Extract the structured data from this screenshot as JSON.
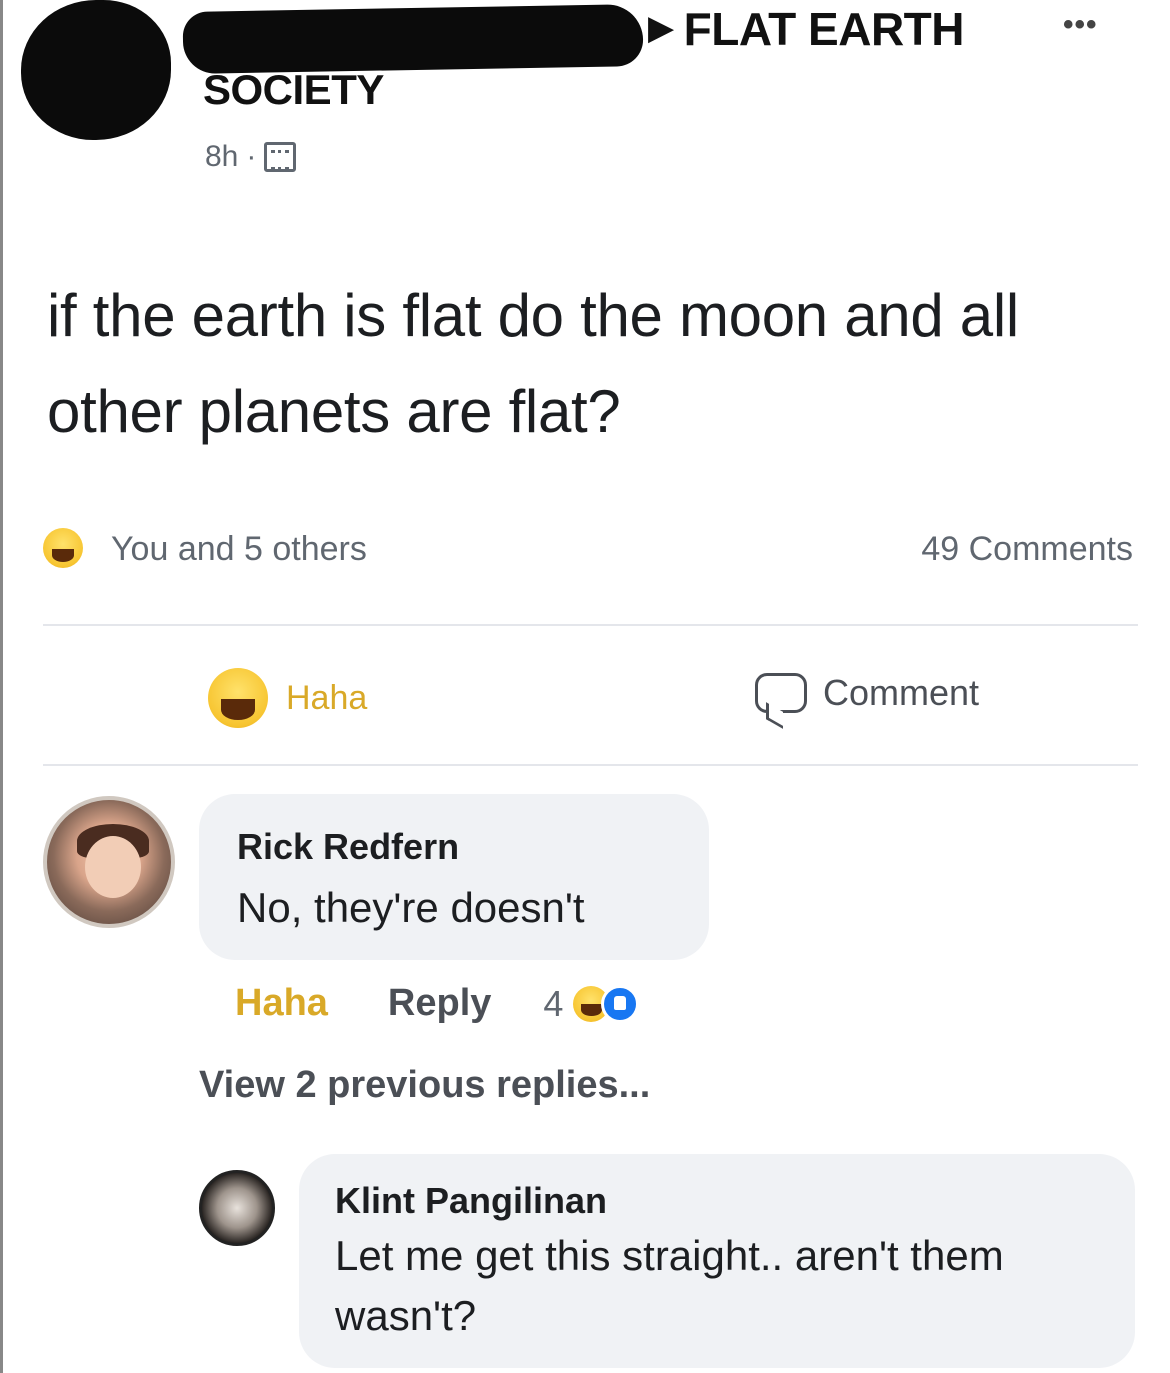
{
  "post": {
    "breadcrumb_separator": "▶",
    "group_name_visible": "FLAT EARTH",
    "group_name_tail": "SOCIETY",
    "more_icon": "•••",
    "timestamp": "8h",
    "meta_separator": "·",
    "audience_icon": "globe-icon",
    "text": "if the earth is flat do the moon and all other planets are flat?"
  },
  "reactions_summary": {
    "icon": "haha-reaction-icon",
    "who": "You and 5 others",
    "comments_count": "49 Comments"
  },
  "action_bar": {
    "haha_label": "Haha",
    "comment_label": "Comment"
  },
  "comments": [
    {
      "author": "Rick Redfern",
      "text": "No, they're doesn't",
      "haha_label": "Haha",
      "reply_label": "Reply",
      "reaction_count": "4"
    },
    {
      "author": "Klint Pangilinan",
      "text": "Let me get this straight.. aren't them wasn't?"
    }
  ],
  "view_previous_replies": "View 2 previous replies...",
  "colors": {
    "haha": "#d9a928",
    "bubble_bg": "#f0f2f5",
    "like_blue": "#1877f2",
    "text_secondary": "#606770"
  }
}
